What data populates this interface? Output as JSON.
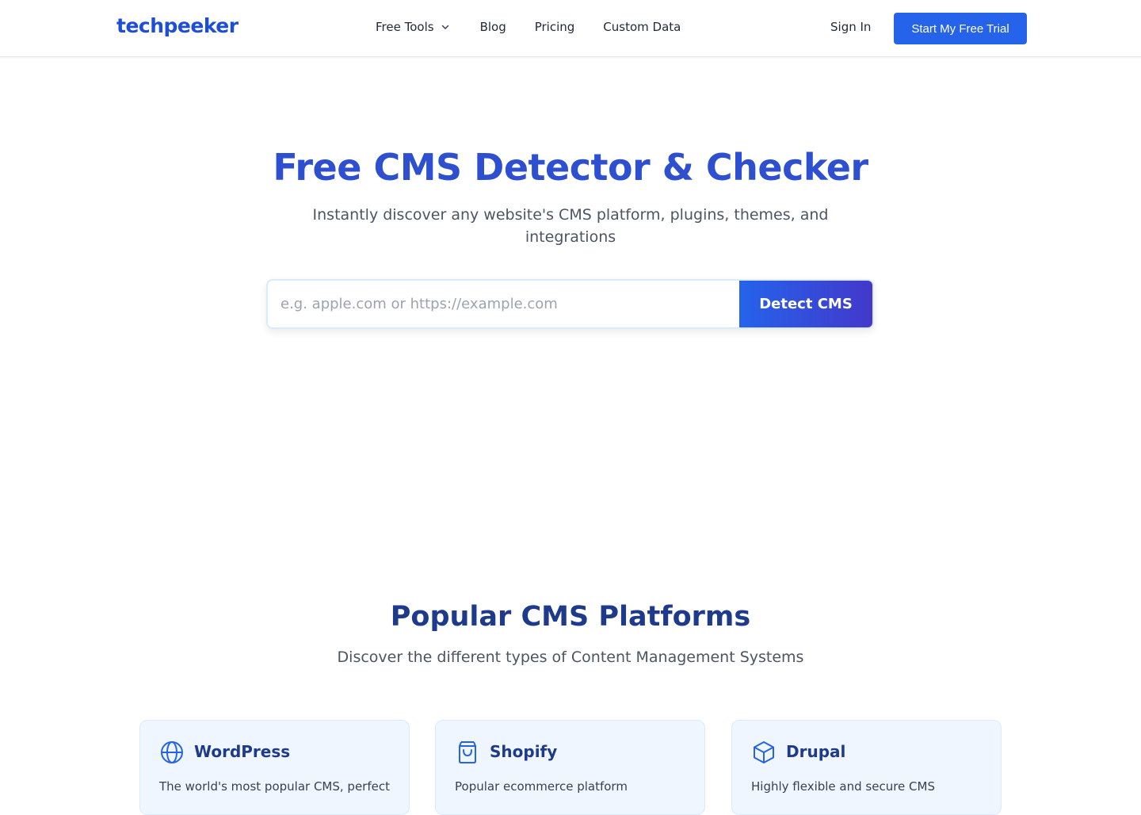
{
  "header": {
    "logo": "techpeeker",
    "nav": [
      {
        "label": "Free Tools",
        "has_dropdown": true
      },
      {
        "label": "Blog"
      },
      {
        "label": "Pricing"
      },
      {
        "label": "Custom Data"
      }
    ],
    "sign_in": "Sign In",
    "trial_button": "Start My Free Trial"
  },
  "hero": {
    "title": "Free CMS Detector & Checker",
    "subtitle": "Instantly discover any website's CMS platform, plugins, themes, and integrations",
    "search_placeholder": "e.g. apple.com or https://example.com",
    "search_value": "",
    "detect_button": "Detect CMS"
  },
  "popular": {
    "title": "Popular CMS Platforms",
    "subtitle": "Discover the different types of Content Management Systems",
    "cards": [
      {
        "name": "WordPress",
        "icon": "globe-icon",
        "desc": "The world's most popular CMS, perfect"
      },
      {
        "name": "Shopify",
        "icon": "shopping-bag-icon",
        "desc": "Popular ecommerce platform"
      },
      {
        "name": "Drupal",
        "icon": "cube-icon",
        "desc": "Highly flexible and secure CMS"
      }
    ]
  },
  "colors": {
    "brand": "#2563eb",
    "title": "#2d4fd0",
    "heading_dark": "#1e3a8a",
    "card_bg": "#eff6ff"
  }
}
